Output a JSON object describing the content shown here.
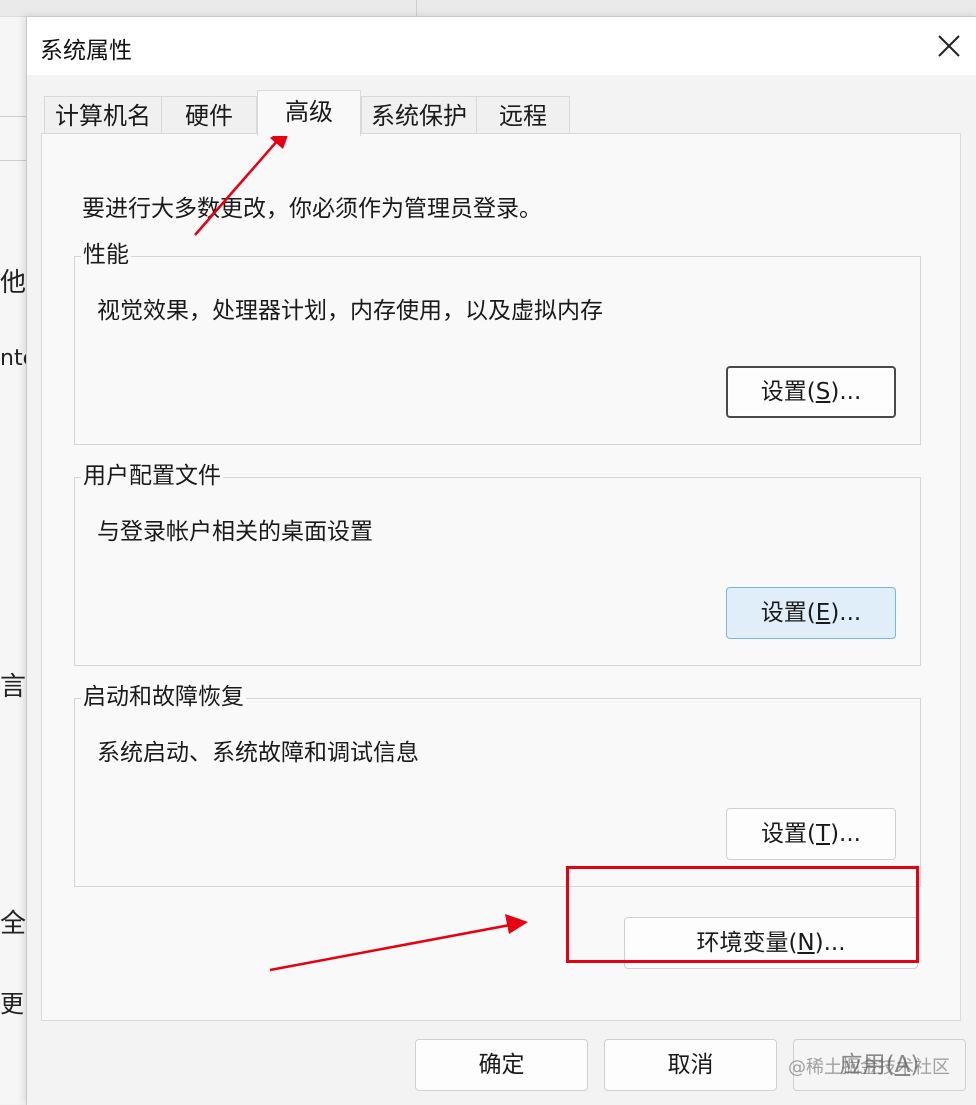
{
  "background": {
    "fragments": [
      "他",
      "nte",
      "言",
      "全",
      "更"
    ]
  },
  "window": {
    "title": "系统属性",
    "close_icon": "close-icon"
  },
  "tabs": [
    {
      "label": "计算机名",
      "active": false
    },
    {
      "label": "硬件",
      "active": false
    },
    {
      "label": "高级",
      "active": true
    },
    {
      "label": "系统保护",
      "active": false
    },
    {
      "label": "远程",
      "active": false
    }
  ],
  "advanced": {
    "admin_note": "要进行大多数更改，你必须作为管理员登录。",
    "performance": {
      "title": "性能",
      "description": "视觉效果，处理器计划，内存使用，以及虚拟内存",
      "button": {
        "text": "设置(",
        "mnemonic": "S",
        "suffix": ")..."
      }
    },
    "user_profiles": {
      "title": "用户配置文件",
      "description": "与登录帐户相关的桌面设置",
      "button": {
        "text": "设置(",
        "mnemonic": "E",
        "suffix": ")..."
      }
    },
    "startup_recovery": {
      "title": "启动和故障恢复",
      "description": "系统启动、系统故障和调试信息",
      "button": {
        "text": "设置(",
        "mnemonic": "T",
        "suffix": ")..."
      }
    },
    "env_button": {
      "text": "环境变量(",
      "mnemonic": "N",
      "suffix": ")..."
    }
  },
  "footer": {
    "ok": "确定",
    "cancel": "取消",
    "apply": {
      "text": "应用(",
      "mnemonic": "A",
      "suffix": ")"
    }
  },
  "annotations": {
    "highlight_color": "#e60012"
  },
  "watermark": "@稀土掘金技术社区"
}
